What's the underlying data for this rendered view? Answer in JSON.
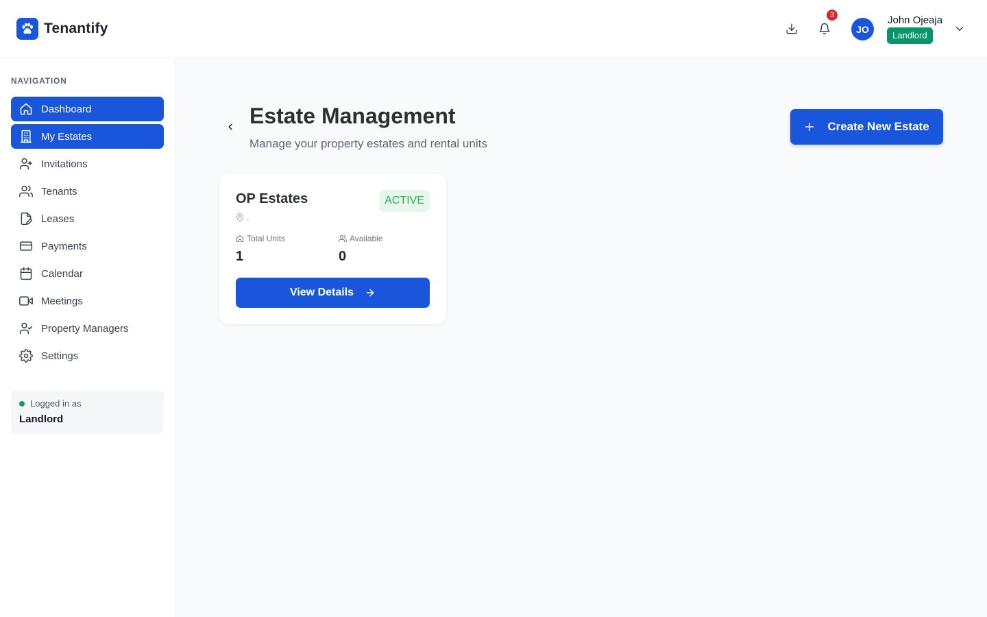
{
  "app": {
    "name": "Tenantify"
  },
  "header": {
    "notifications_count": "3",
    "user": {
      "initials": "JO",
      "name": "John Ojeaja",
      "role": "Landlord"
    }
  },
  "sidebar": {
    "heading": "NAVIGATION",
    "items": [
      {
        "label": "Dashboard",
        "icon": "home-icon",
        "active": true
      },
      {
        "label": "My Estates",
        "icon": "building-icon",
        "active": true
      },
      {
        "label": "Invitations",
        "icon": "user-plus-icon",
        "active": false
      },
      {
        "label": "Tenants",
        "icon": "users-icon",
        "active": false
      },
      {
        "label": "Leases",
        "icon": "file-edit-icon",
        "active": false
      },
      {
        "label": "Payments",
        "icon": "credit-card-icon",
        "active": false
      },
      {
        "label": "Calendar",
        "icon": "calendar-icon",
        "active": false
      },
      {
        "label": "Meetings",
        "icon": "video-icon",
        "active": false
      },
      {
        "label": "Property Managers",
        "icon": "user-check-icon",
        "active": false
      },
      {
        "label": "Settings",
        "icon": "gear-icon",
        "active": false
      }
    ],
    "login_status": {
      "label": "Logged in as",
      "role": "Landlord"
    }
  },
  "main": {
    "title": "Estate Management",
    "subtitle": "Manage your property estates and rental units",
    "create_button": "Create New Estate",
    "estates": [
      {
        "name": "OP Estates",
        "status": "ACTIVE",
        "location": ",",
        "total_units_label": "Total Units",
        "total_units": "1",
        "available_label": "Available",
        "available": "0",
        "view_button": "View Details"
      }
    ]
  },
  "colors": {
    "primary": "#1a56db",
    "status_active_bg": "#e7f7ec",
    "status_active_text": "#22b355",
    "role_badge": "#079669",
    "notification_badge": "#dc2626"
  }
}
